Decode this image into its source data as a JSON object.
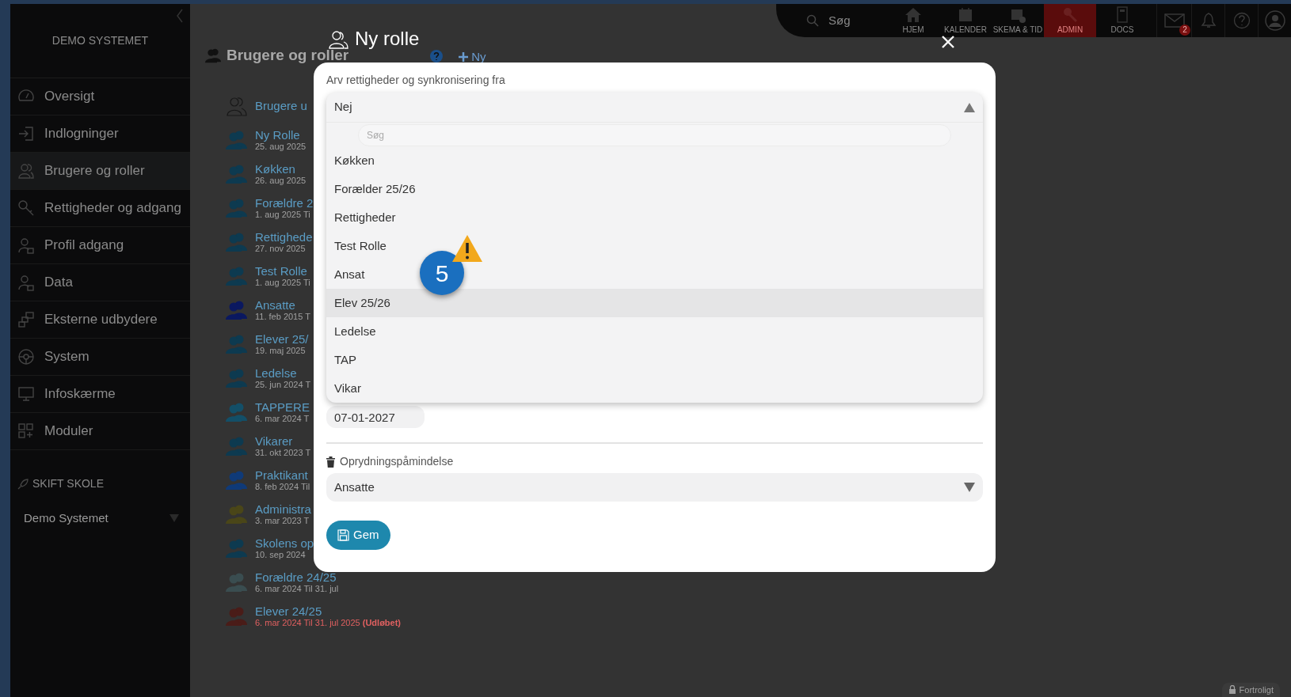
{
  "sidebar": {
    "title": "DEMO SYSTEMET",
    "items": [
      {
        "label": "Oversigt",
        "selected": false
      },
      {
        "label": "Indlogninger",
        "selected": false
      },
      {
        "label": "Brugere og roller",
        "selected": true
      },
      {
        "label": "Rettigheder og adgang",
        "selected": false
      },
      {
        "label": "Profil adgang",
        "selected": false
      },
      {
        "label": "Data",
        "selected": false
      },
      {
        "label": "Eksterne udbydere",
        "selected": false
      },
      {
        "label": "System",
        "selected": false
      },
      {
        "label": "Infoskærme",
        "selected": false
      },
      {
        "label": "Moduler",
        "selected": false
      }
    ],
    "switch_school": {
      "label": "SKIFT SKOLE",
      "value": "Demo Systemet"
    }
  },
  "top_nav": {
    "search": {
      "placeholder": "Søg"
    },
    "items": [
      {
        "label": "HJEM",
        "selected": false
      },
      {
        "label": "KALENDER",
        "selected": false
      },
      {
        "label": "SKEMA & TID",
        "selected": false
      },
      {
        "label": "ADMIN",
        "selected": true
      },
      {
        "label": "DOCS",
        "selected": false
      }
    ],
    "mail_badge": "2"
  },
  "page": {
    "title": "Brugere og roller",
    "new_link": "Ny",
    "roles": [
      {
        "name": "Brugere u",
        "kind": "outline"
      },
      {
        "name": "Ny Rolle",
        "dates": "25. aug 2025",
        "color": "#0d3a50",
        "kind": "role"
      },
      {
        "name": "Køkken",
        "dates": "26. aug 2025",
        "color": "#0d3a50",
        "kind": "role"
      },
      {
        "name": "Forældre 2",
        "dates": "1. aug 2025 Ti",
        "color": "#0d3a50",
        "kind": "role"
      },
      {
        "name": "Rettighede",
        "dates": "27. nov 2025",
        "color": "#0d3a50",
        "kind": "role"
      },
      {
        "name": "Test Rolle",
        "dates": "1. aug 2025 Ti",
        "color": "#0d3a50",
        "kind": "role"
      },
      {
        "name": "Ansatte",
        "dates": "11. feb 2015 T",
        "color": "#0a1860",
        "kind": "role"
      },
      {
        "name": "Elever 25/",
        "dates": "19. maj 2025",
        "color": "#0d3a50",
        "kind": "role"
      },
      {
        "name": "Ledelse",
        "dates": "25. jun 2024 T",
        "color": "#0d3a50",
        "kind": "role"
      },
      {
        "name": "TAPPERE",
        "dates": "6. mar 2024 T",
        "color": "#134f68",
        "kind": "role"
      },
      {
        "name": "Vikarer",
        "dates": "31. okt 2023 T",
        "color": "#0d3a50",
        "kind": "role"
      },
      {
        "name": "Praktikant",
        "dates": "8. feb 2024 Til",
        "color": "#0f3a78",
        "kind": "role"
      },
      {
        "name": "Administra",
        "dates": "3. mar 2023 T",
        "color": "#4a4618",
        "kind": "role"
      },
      {
        "name": "Skolens op",
        "dates": "10. sep 2024",
        "color": "#0d3a50",
        "kind": "role"
      },
      {
        "name": "Forældre 24/25",
        "dates": "6. mar 2024 Til 31. jul",
        "color": "#3a4d50",
        "kind": "role"
      },
      {
        "name": "Elever 24/25",
        "dates": "6. mar 2024 Til 31. jul 2025 **(Udløbet)**",
        "color": "#4a1c18",
        "kind": "expired"
      }
    ]
  },
  "modal": {
    "title": "Ny rolle",
    "inherit": {
      "label": "Arv rettigheder og synkronisering fra",
      "value": "Nej",
      "expanded": true,
      "search": {
        "placeholder": "Søg"
      },
      "options": [
        {
          "label": "Køkken",
          "selected": false
        },
        {
          "label": "Forælder 25/26",
          "selected": false
        },
        {
          "label": "Rettigheder",
          "selected": false
        },
        {
          "label": "Test Rolle",
          "selected": false
        },
        {
          "label": "Ansat",
          "selected": false
        },
        {
          "label": "Elev 25/26",
          "selected": true
        },
        {
          "label": "Ledelse",
          "selected": false
        },
        {
          "label": "TAP",
          "selected": false
        },
        {
          "label": "Vikar",
          "selected": false
        }
      ]
    },
    "date_value": "07-01-2027",
    "cleanup": {
      "label": "Oprydningspåmindelse",
      "value": "Ansatte",
      "expanded": false
    },
    "save_button": "Gem"
  },
  "tutorial_step": "5",
  "confidential": "Fortroligt"
}
